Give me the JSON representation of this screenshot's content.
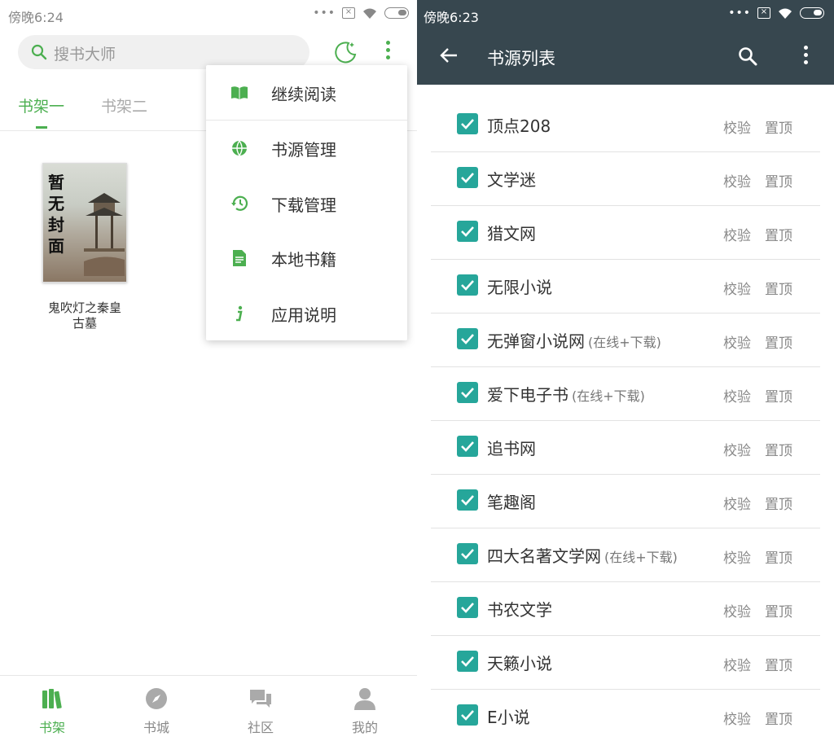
{
  "left_screen": {
    "status": {
      "time": "傍晚6:24"
    },
    "search": {
      "placeholder": "搜书大师"
    },
    "tabs": [
      {
        "label": "书架一"
      },
      {
        "label": "书架二"
      }
    ],
    "book": {
      "cover_text": "暂无封面",
      "title": "鬼吹灯之秦皇古墓"
    },
    "menu": {
      "items": [
        {
          "label": "继续阅读",
          "icon": "book-open-icon"
        },
        {
          "label": "书源管理",
          "icon": "globe-icon"
        },
        {
          "label": "下载管理",
          "icon": "history-icon"
        },
        {
          "label": "本地书籍",
          "icon": "document-icon"
        },
        {
          "label": "应用说明",
          "icon": "info-icon"
        }
      ]
    },
    "bottom_nav": [
      {
        "label": "书架",
        "icon": "bookshelf-icon"
      },
      {
        "label": "书城",
        "icon": "compass-icon"
      },
      {
        "label": "社区",
        "icon": "chat-icon"
      },
      {
        "label": "我的",
        "icon": "person-icon"
      }
    ]
  },
  "right_screen": {
    "status": {
      "time": "傍晚6:23"
    },
    "header": {
      "title": "书源列表"
    },
    "actions": {
      "verify": "校验",
      "pin": "置顶"
    },
    "sources": [
      {
        "name": "顶点208",
        "tag": ""
      },
      {
        "name": "文学迷",
        "tag": ""
      },
      {
        "name": "猎文网",
        "tag": ""
      },
      {
        "name": "无限小说",
        "tag": ""
      },
      {
        "name": "无弹窗小说网",
        "tag": "(在线+下载)"
      },
      {
        "name": "爱下电子书",
        "tag": "(在线+下载)"
      },
      {
        "name": "追书网",
        "tag": ""
      },
      {
        "name": "笔趣阁",
        "tag": ""
      },
      {
        "name": "四大名著文学网",
        "tag": "(在线+下载)"
      },
      {
        "name": "书农文学",
        "tag": ""
      },
      {
        "name": "天籁小说",
        "tag": ""
      },
      {
        "name": "E小说",
        "tag": ""
      }
    ]
  },
  "colors": {
    "accent_green": "#4caf50",
    "header_dark": "#37474f",
    "checkbox_teal": "#26a69a"
  }
}
